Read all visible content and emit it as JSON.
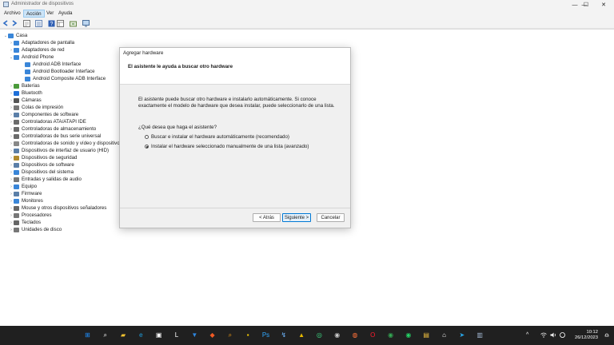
{
  "window": {
    "title": "Administrador de dispositivos",
    "controls": {
      "minimize": "—",
      "maximize": "☐",
      "close": "✕"
    }
  },
  "menu": [
    "Archivo",
    "Acción",
    "Ver",
    "Ayuda"
  ],
  "menu_active": "Acción",
  "toolbar": [
    "back-icon",
    "forward-icon",
    "properties-icon",
    "tree-view-icon",
    "help-icon",
    "view-icon",
    "refresh-icon",
    "monitor-icon"
  ],
  "tree": {
    "root": "Casa",
    "items": [
      {
        "label": "Adaptadores de pantalla",
        "icon_color": "#3a86d8",
        "expanded": false
      },
      {
        "label": "Adaptadores de red",
        "icon_color": "#3a86d8",
        "expanded": false
      },
      {
        "label": "Android Phone",
        "icon_color": "#3a86d8",
        "expanded": true,
        "children": [
          "Android ADB Interface",
          "Android Bootloader Interface",
          "Android Composite ADB Interface"
        ]
      },
      {
        "label": "Baterías",
        "icon_color": "#4a9a3a",
        "expanded": false
      },
      {
        "label": "Bluetooth",
        "icon_color": "#1e6fd9",
        "expanded": false
      },
      {
        "label": "Cámaras",
        "icon_color": "#555555",
        "expanded": false
      },
      {
        "label": "Colas de impresión",
        "icon_color": "#777777",
        "expanded": false
      },
      {
        "label": "Componentes de software",
        "icon_color": "#5b7fa8",
        "expanded": false
      },
      {
        "label": "Controladoras ATA/ATAPI IDE",
        "icon_color": "#6b6b6b",
        "expanded": false
      },
      {
        "label": "Controladoras de almacenamiento",
        "icon_color": "#6b6b6b",
        "expanded": false
      },
      {
        "label": "Controladoras de bus serie universal",
        "icon_color": "#6b6b6b",
        "expanded": false
      },
      {
        "label": "Controladoras de sonido y vídeo y dispositivos de juego",
        "icon_color": "#888888",
        "expanded": false
      },
      {
        "label": "Dispositivos de interfaz de usuario (HID)",
        "icon_color": "#5b7fa8",
        "expanded": false
      },
      {
        "label": "Dispositivos de seguridad",
        "icon_color": "#b08a2e",
        "expanded": false
      },
      {
        "label": "Dispositivos de software",
        "icon_color": "#5b7fa8",
        "expanded": false
      },
      {
        "label": "Dispositivos del sistema",
        "icon_color": "#3a86d8",
        "expanded": false
      },
      {
        "label": "Entradas y salidas de audio",
        "icon_color": "#777777",
        "expanded": false
      },
      {
        "label": "Equipo",
        "icon_color": "#3a86d8",
        "expanded": false
      },
      {
        "label": "Firmware",
        "icon_color": "#5b7fa8",
        "expanded": false
      },
      {
        "label": "Monitores",
        "icon_color": "#3a86d8",
        "expanded": false
      },
      {
        "label": "Mouse y otros dispositivos señaladores",
        "icon_color": "#666666",
        "expanded": false
      },
      {
        "label": "Procesadores",
        "icon_color": "#777777",
        "expanded": false
      },
      {
        "label": "Teclados",
        "icon_color": "#666666",
        "expanded": false
      },
      {
        "label": "Unidades de disco",
        "icon_color": "#777777",
        "expanded": false
      }
    ]
  },
  "dialog": {
    "title": "Agregar hardware",
    "header": "El asistente le ayuda a buscar otro hardware",
    "description_line1": "El asistente puede buscar otro hardware e instalarlo automáticamente. Si conoce",
    "description_line2": "exactamente el modelo de hardware que desea instalar, puede seleccionarlo de una lista.",
    "question": "¿Qué desea que haga el asistente?",
    "options": [
      {
        "label": "Buscar e instalar el hardware automáticamente (recomendado)",
        "selected": false
      },
      {
        "label": "Instalar el hardware seleccionado manualmente de una lista (avanzado)",
        "selected": true
      }
    ],
    "buttons": {
      "back": "< Atrás",
      "next": "Siguiente >",
      "cancel": "Cancelar"
    }
  },
  "taskbar": {
    "apps": [
      "start-icon",
      "search-icon",
      "file-explorer-icon",
      "edge-icon",
      "store-icon",
      "launcher-icon",
      "vpn-icon",
      "brave-icon",
      "search-app-icon",
      "notes-icon",
      "photoshop-icon",
      "dev-tool-icon",
      "alert-icon",
      "game-icon",
      "recorder-icon",
      "firefox-icon",
      "opera-icon",
      "chrome-icon",
      "whatsapp-icon",
      "files-icon",
      "tool-icon",
      "telegram-icon",
      "device-manager-icon"
    ],
    "time": "10:12",
    "date": "26/12/2023"
  }
}
